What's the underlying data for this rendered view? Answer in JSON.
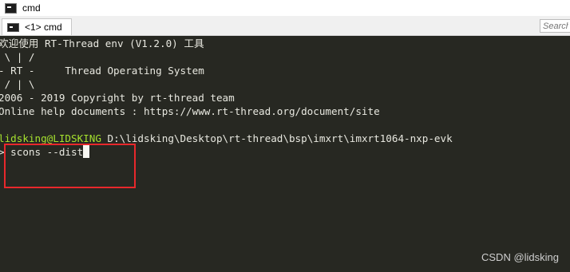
{
  "window": {
    "title": "cmd"
  },
  "tabs": [
    {
      "label": "<1> cmd"
    }
  ],
  "search": {
    "placeholder": "Search"
  },
  "terminal": {
    "banner": [
      "欢迎使用 RT-Thread env (V1.2.0) 工具",
      " \\ | /",
      "- RT -     Thread Operating System",
      " / | \\",
      "2006 - 2019 Copyright by rt-thread team",
      "Online help documents : https://www.rt-thread.org/document/site"
    ],
    "prompt_user": "lidsking@LIDSKING",
    "prompt_path": "D:\\lidsking\\Desktop\\rt-thread\\bsp\\imxrt\\imxrt1064-nxp-evk",
    "prompt_symbol": "> ",
    "command": "scons --dist"
  },
  "watermark": "CSDN @lidsking",
  "colors": {
    "terminal_bg": "#272822",
    "prompt_user": "#a6e22e",
    "highlight": "#e8282c"
  }
}
